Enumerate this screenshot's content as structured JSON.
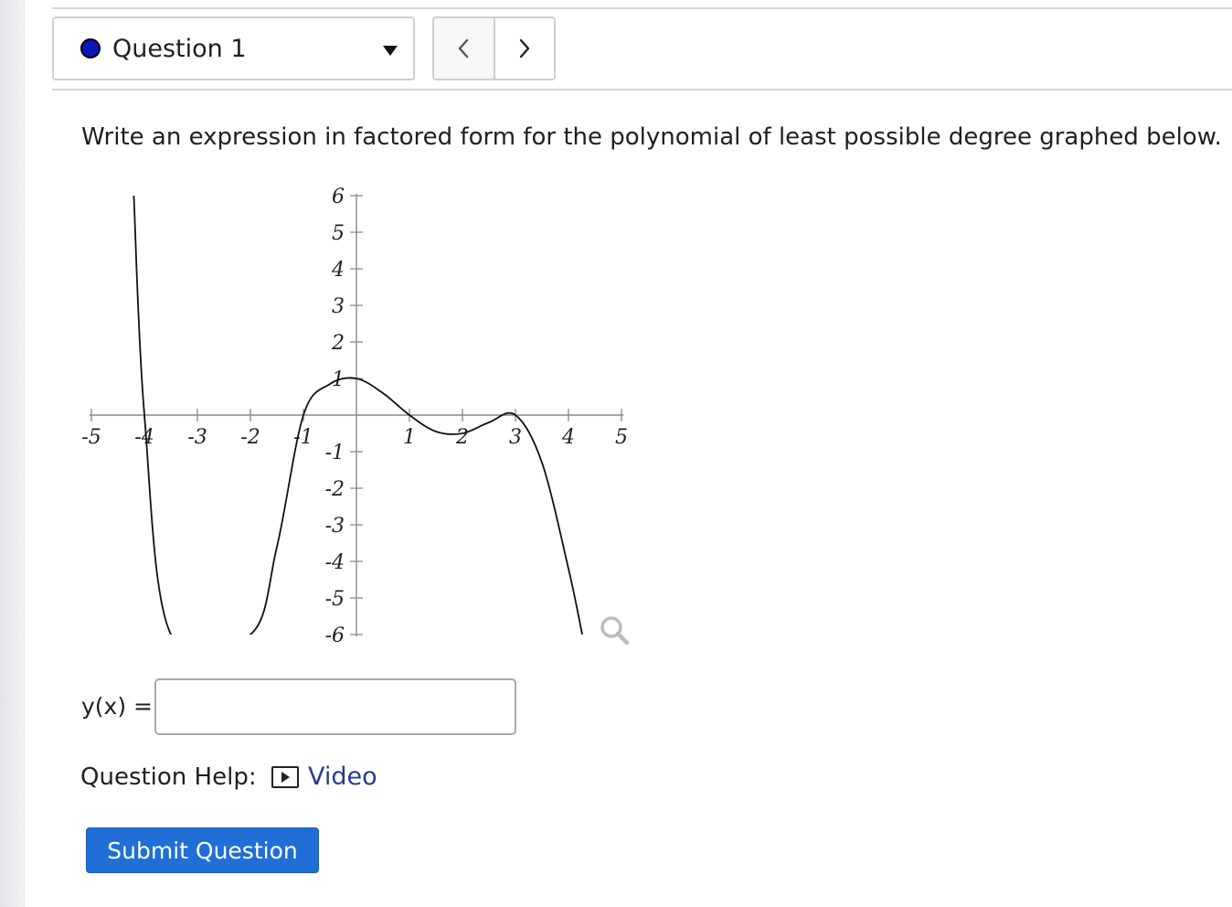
{
  "question_selector": {
    "label": "Question 1",
    "status_color": "#0a16b8"
  },
  "nav": {
    "prev_icon": "chevron-left-icon",
    "next_icon": "chevron-right-icon"
  },
  "prompt": "Write an expression in factored form for the polynomial of least possible degree graphed below.",
  "chart_data": {
    "type": "line",
    "xlim": [
      -5,
      5
    ],
    "ylim": [
      -6,
      6
    ],
    "x_ticks": [
      -5,
      -4,
      -3,
      -2,
      -1,
      1,
      2,
      3,
      4,
      5
    ],
    "y_ticks": [
      -6,
      -5,
      -4,
      -3,
      -2,
      -1,
      1,
      2,
      3,
      4,
      5,
      6
    ],
    "grid": false,
    "series": [
      {
        "x": [
          -4.2,
          -4.0,
          -3.5,
          -2.0,
          -1.5,
          -1.0,
          -0.5,
          0.0,
          0.5,
          1.0,
          1.5,
          2.0,
          2.5,
          3.0,
          3.5,
          4.0,
          4.26
        ],
        "y": [
          6,
          0,
          -6,
          -6,
          -3.6,
          0,
          0.85,
          1.0,
          0.6,
          0,
          -0.45,
          -0.5,
          -0.2,
          0,
          -1.3,
          -4.2,
          -6
        ]
      }
    ]
  },
  "zoom_icon": "magnifier-icon",
  "answer": {
    "label": "y(x) =",
    "value": ""
  },
  "help": {
    "label": "Question Help:",
    "video_label": "Video",
    "video_icon": "play-icon",
    "link_color": "#2a3a8f"
  },
  "submit": {
    "label": "Submit Question",
    "color": "#1f6fd6"
  }
}
